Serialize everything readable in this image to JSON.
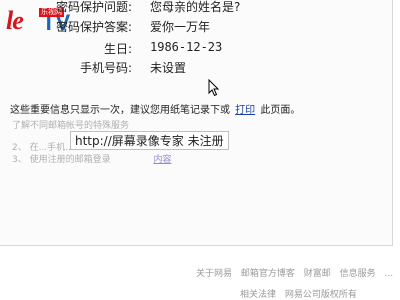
{
  "logo": {
    "brand_le": "le",
    "brand_tv": "TV",
    "badge": "乐视网"
  },
  "fields": [
    {
      "label": "密码保护问题:",
      "value": "您母亲的姓名是?"
    },
    {
      "label": "密码保护答案:",
      "value": "爱你一万年"
    },
    {
      "label": "生日:",
      "value": "1986-12-23"
    },
    {
      "label": "手机号码:",
      "value": "未设置"
    }
  ],
  "notice": {
    "before": "这些重要信息只显示一次，建议您用纸笔记录下或",
    "link": "打印",
    "after": "此页面。"
  },
  "faded_lines": [
    "了解不同邮箱帐号的特殊服务",
    "2、 在...手机...",
    "3、 使用注册的邮箱登录",
    "内容"
  ],
  "watermark": "http://屏幕录像专家 未注册",
  "footer": {
    "row1": [
      "关于网易",
      "邮箱官方博客",
      "财富邮",
      "信息服务",
      "..."
    ],
    "row2": [
      "相关法律",
      "网易公司版权所有"
    ]
  }
}
